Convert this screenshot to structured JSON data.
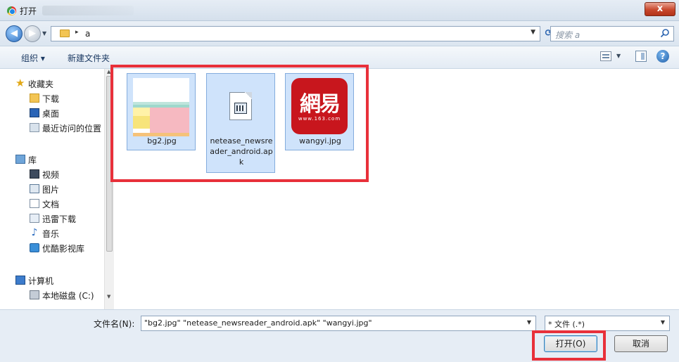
{
  "window": {
    "title": "打开",
    "close_label": "x"
  },
  "address": {
    "breadcrumb_sep": "▸",
    "current_folder": "a",
    "search_placeholder": "搜索 a"
  },
  "toolbar": {
    "organize": "组织 ▾",
    "new_folder": "新建文件夹",
    "help": "?"
  },
  "nav": {
    "favorites_label": "收藏夹",
    "favorites": [
      "下载",
      "桌面",
      "最近访问的位置"
    ],
    "libraries_label": "库",
    "libraries": [
      "视频",
      "图片",
      "文档",
      "迅雷下载",
      "音乐",
      "优酷影视库"
    ],
    "computer_label": "计算机",
    "drives": [
      "本地磁盘 (C:)"
    ]
  },
  "files": [
    {
      "name": "bg2.jpg",
      "selected": true
    },
    {
      "name": "netease_newsreader_android.apk",
      "selected": true
    },
    {
      "name": "wangyi.jpg",
      "selected": true
    }
  ],
  "wangyi_logo": {
    "text": "網易",
    "sub": "www.163.com"
  },
  "bottom": {
    "filename_label": "文件名(N):",
    "filename_value": "\"bg2.jpg\" \"netease_newsreader_android.apk\" \"wangyi.jpg\"",
    "filetype_value": "* 文件 (.*)",
    "open_button": "打开(O)",
    "cancel_button": "取消"
  },
  "colors": {
    "highlight_box": "#e8303a",
    "selection": "#cfe3fb",
    "close": "#c8482d"
  }
}
